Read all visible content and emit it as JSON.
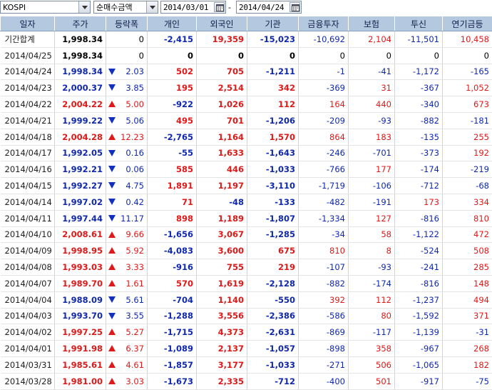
{
  "toolbar": {
    "market": "KOSPI",
    "amount_type": "순매수금액",
    "start_date": "2014/03/01",
    "end_date": "2014/04/24",
    "separator": "-"
  },
  "table": {
    "headers": [
      "일자",
      "주가",
      "등락폭",
      "개인",
      "외국인",
      "기관",
      "금융투자",
      "보험",
      "투신",
      "연기금등"
    ],
    "summary": {
      "label": "기간합계",
      "price": "1,998.34",
      "change": "0",
      "values": [
        "-2,415",
        "19,359",
        "-15,023",
        "-10,692",
        "2,104",
        "-11,501",
        "10,458"
      ]
    },
    "rows": [
      {
        "date": "2014/04/25",
        "price": "1,998.34",
        "dir": "none",
        "change": "0",
        "values": [
          "0",
          "0",
          "0",
          "0",
          "0",
          "0",
          "0"
        ]
      },
      {
        "date": "2014/04/24",
        "price": "1,998.34",
        "dir": "down",
        "change": "2.03",
        "values": [
          "502",
          "705",
          "-1,211",
          "-1",
          "-41",
          "-1,172",
          "-165"
        ]
      },
      {
        "date": "2014/04/23",
        "price": "2,000.37",
        "dir": "down",
        "change": "3.85",
        "values": [
          "195",
          "2,514",
          "342",
          "-369",
          "31",
          "-367",
          "1,052"
        ]
      },
      {
        "date": "2014/04/22",
        "price": "2,004.22",
        "dir": "up",
        "change": "5.00",
        "values": [
          "-922",
          "1,026",
          "112",
          "164",
          "440",
          "-340",
          "673"
        ]
      },
      {
        "date": "2014/04/21",
        "price": "1,999.22",
        "dir": "down",
        "change": "5.06",
        "values": [
          "495",
          "701",
          "-1,206",
          "-209",
          "-93",
          "-882",
          "-181"
        ]
      },
      {
        "date": "2014/04/18",
        "price": "2,004.28",
        "dir": "up",
        "change": "12.23",
        "values": [
          "-2,765",
          "1,164",
          "1,570",
          "864",
          "183",
          "-135",
          "255"
        ]
      },
      {
        "date": "2014/04/17",
        "price": "1,992.05",
        "dir": "down",
        "change": "0.16",
        "values": [
          "-55",
          "1,633",
          "-1,643",
          "-246",
          "-701",
          "-373",
          "192"
        ]
      },
      {
        "date": "2014/04/16",
        "price": "1,992.21",
        "dir": "down",
        "change": "0.06",
        "values": [
          "585",
          "446",
          "-1,033",
          "-766",
          "177",
          "-174",
          "-219"
        ]
      },
      {
        "date": "2014/04/15",
        "price": "1,992.27",
        "dir": "down",
        "change": "4.75",
        "values": [
          "1,891",
          "1,197",
          "-3,110",
          "-1,719",
          "-106",
          "-712",
          "-68"
        ]
      },
      {
        "date": "2014/04/14",
        "price": "1,997.02",
        "dir": "down",
        "change": "0.42",
        "values": [
          "71",
          "-48",
          "-133",
          "-482",
          "-191",
          "173",
          "334"
        ]
      },
      {
        "date": "2014/04/11",
        "price": "1,997.44",
        "dir": "down",
        "change": "11.17",
        "values": [
          "898",
          "1,189",
          "-1,807",
          "-1,334",
          "127",
          "-816",
          "810"
        ]
      },
      {
        "date": "2014/04/10",
        "price": "2,008.61",
        "dir": "up",
        "change": "9.66",
        "values": [
          "-1,656",
          "3,067",
          "-1,285",
          "-34",
          "58",
          "-1,122",
          "472"
        ]
      },
      {
        "date": "2014/04/09",
        "price": "1,998.95",
        "dir": "up",
        "change": "5.92",
        "values": [
          "-4,083",
          "3,600",
          "675",
          "810",
          "8",
          "-524",
          "508"
        ]
      },
      {
        "date": "2014/04/08",
        "price": "1,993.03",
        "dir": "up",
        "change": "3.33",
        "values": [
          "-916",
          "755",
          "219",
          "-107",
          "-93",
          "-241",
          "285"
        ]
      },
      {
        "date": "2014/04/07",
        "price": "1,989.70",
        "dir": "up",
        "change": "1.61",
        "values": [
          "570",
          "1,619",
          "-2,128",
          "-882",
          "-174",
          "-816",
          "148"
        ]
      },
      {
        "date": "2014/04/04",
        "price": "1,988.09",
        "dir": "down",
        "change": "5.61",
        "values": [
          "-704",
          "1,140",
          "-550",
          "392",
          "112",
          "-1,237",
          "494"
        ]
      },
      {
        "date": "2014/04/03",
        "price": "1,993.70",
        "dir": "down",
        "change": "3.55",
        "values": [
          "-1,288",
          "3,556",
          "-2,386",
          "-586",
          "80",
          "-1,592",
          "371"
        ]
      },
      {
        "date": "2014/04/02",
        "price": "1,997.25",
        "dir": "up",
        "change": "5.27",
        "values": [
          "-1,715",
          "4,373",
          "-2,631",
          "-869",
          "-117",
          "-1,139",
          "-31"
        ]
      },
      {
        "date": "2014/04/01",
        "price": "1,991.98",
        "dir": "up",
        "change": "6.37",
        "values": [
          "-1,089",
          "2,137",
          "-1,057",
          "-898",
          "358",
          "-967",
          "268"
        ]
      },
      {
        "date": "2014/03/31",
        "price": "1,985.61",
        "dir": "up",
        "change": "4.61",
        "values": [
          "-1,857",
          "3,177",
          "-1,033",
          "-271",
          "506",
          "-1,065",
          "182"
        ]
      },
      {
        "date": "2014/03/28",
        "price": "1,981.00",
        "dir": "up",
        "change": "3.03",
        "values": [
          "-1,673",
          "2,335",
          "-712",
          "-400",
          "501",
          "-917",
          "-75"
        ]
      }
    ]
  },
  "colors": {
    "up": "#e01818",
    "down": "#1028b0",
    "header_bg": "#b4c8e0"
  },
  "icons": {
    "dropdown": "chevron-down-icon",
    "calendar": "calendar-icon",
    "up": "triangle-up-icon",
    "down": "triangle-down-icon"
  }
}
